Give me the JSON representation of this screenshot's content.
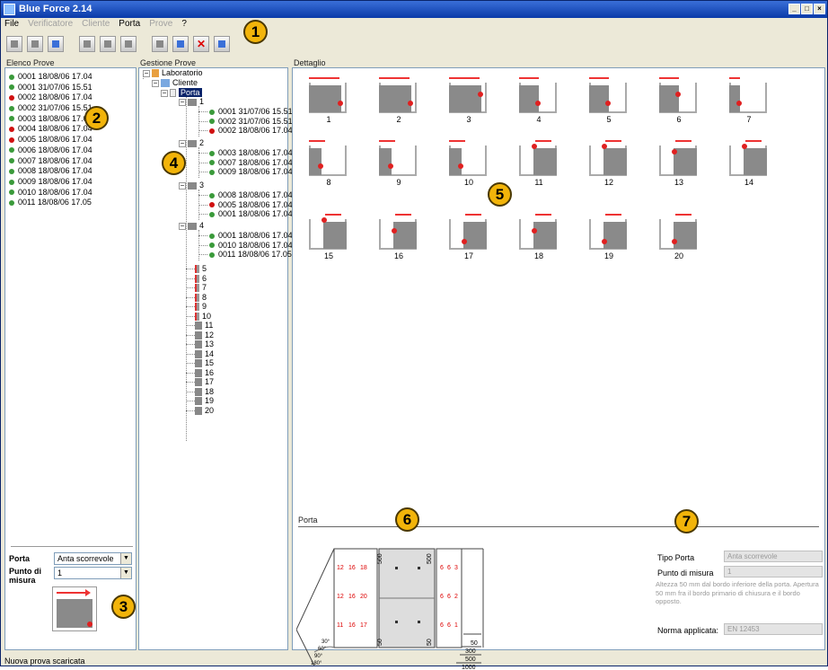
{
  "window": {
    "title": "Blue Force 2.14"
  },
  "menu": [
    {
      "label": "File",
      "enabled": true
    },
    {
      "label": "Verificatore",
      "enabled": false
    },
    {
      "label": "Cliente",
      "enabled": false
    },
    {
      "label": "Porta",
      "enabled": true
    },
    {
      "label": "Prove",
      "enabled": false
    },
    {
      "label": "?",
      "enabled": true
    }
  ],
  "toolbar": {
    "buttons": [
      {
        "icon": "new-doc-icon"
      },
      {
        "icon": "open-doc-icon"
      },
      {
        "icon": "save-icon"
      },
      {
        "icon": "user-icon"
      },
      {
        "icon": "client-icon"
      },
      {
        "icon": "door-icon"
      },
      {
        "icon": "chart-icon"
      },
      {
        "icon": "chart-color-icon"
      },
      {
        "icon": "delete-icon"
      },
      {
        "icon": "print-icon"
      }
    ]
  },
  "left_panel": {
    "title": "Elenco Prove",
    "items": [
      {
        "label": "0001 18/08/06 17.04",
        "status": "green"
      },
      {
        "label": "0001 31/07/06 15.51",
        "status": "green"
      },
      {
        "label": "0002 18/08/06 17.04",
        "status": "red"
      },
      {
        "label": "0002 31/07/06 15.51",
        "status": "green"
      },
      {
        "label": "0003 18/08/06 17.04",
        "status": "green"
      },
      {
        "label": "0004 18/08/06 17.04",
        "status": "red"
      },
      {
        "label": "0005 18/08/06 17.04",
        "status": "red"
      },
      {
        "label": "0006 18/08/06 17.04",
        "status": "green"
      },
      {
        "label": "0007 18/08/06 17.04",
        "status": "green"
      },
      {
        "label": "0008 18/08/06 17.04",
        "status": "green"
      },
      {
        "label": "0009 18/08/06 17.04",
        "status": "green"
      },
      {
        "label": "0010 18/08/06 17.04",
        "status": "green"
      },
      {
        "label": "0011 18/08/06 17.05",
        "status": "green"
      }
    ],
    "porta_label": "Porta",
    "porta_value": "Anta scorrevole",
    "punto_label": "Punto di misura",
    "punto_value": "1"
  },
  "tree_panel": {
    "title": "Gestione Prove",
    "root": "Laboratorio",
    "client": "Cliente",
    "door": "Porta",
    "groups": [
      {
        "num": "1",
        "tests": [
          {
            "label": "0001 31/07/06 15.51",
            "status": "green"
          },
          {
            "label": "0002 31/07/06 15.51",
            "status": "green"
          },
          {
            "label": "0002 18/08/06 17.04",
            "status": "red"
          }
        ]
      },
      {
        "num": "2",
        "tests": [
          {
            "label": "0003 18/08/06 17.04",
            "status": "green"
          },
          {
            "label": "0007 18/08/06 17.04",
            "status": "green"
          },
          {
            "label": "0009 18/08/06 17.04",
            "status": "green"
          }
        ]
      },
      {
        "num": "3",
        "tests": [
          {
            "label": "0008 18/08/06 17.04",
            "status": "green"
          },
          {
            "label": "0005 18/08/06 17.04",
            "status": "red"
          },
          {
            "label": "0001 18/08/06 17.04",
            "status": "green"
          }
        ]
      },
      {
        "num": "4",
        "tests": [
          {
            "label": "0001 18/08/06 17.04",
            "status": "green"
          },
          {
            "label": "0010 18/08/06 17.04",
            "status": "green"
          },
          {
            "label": "0011 18/08/06 17.05",
            "status": "green"
          }
        ]
      }
    ],
    "points": [
      "5",
      "6",
      "7",
      "8",
      "9",
      "10",
      "11",
      "12",
      "13",
      "14",
      "15",
      "16",
      "17",
      "18",
      "19",
      "20"
    ]
  },
  "detail_panel": {
    "title": "Dettaglio",
    "thumbnails": [
      {
        "label": "1",
        "dir": "right"
      },
      {
        "label": "2",
        "dir": "right"
      },
      {
        "label": "3",
        "dir": "right"
      },
      {
        "label": "4",
        "dir": "right"
      },
      {
        "label": "5",
        "dir": "right"
      },
      {
        "label": "6",
        "dir": "right"
      },
      {
        "label": "7",
        "dir": "right"
      },
      {
        "label": "8",
        "dir": "right"
      },
      {
        "label": "9",
        "dir": "right"
      },
      {
        "label": "10",
        "dir": "right"
      },
      {
        "label": "11",
        "dir": "left"
      },
      {
        "label": "12",
        "dir": "left"
      },
      {
        "label": "13",
        "dir": "left"
      },
      {
        "label": "14",
        "dir": "left"
      },
      {
        "label": "15",
        "dir": "left"
      },
      {
        "label": "16",
        "dir": "left"
      },
      {
        "label": "17",
        "dir": "left"
      },
      {
        "label": "18",
        "dir": "left"
      },
      {
        "label": "19",
        "dir": "left"
      },
      {
        "label": "20",
        "dir": "left"
      }
    ]
  },
  "porta_section": {
    "title": "Porta",
    "diagram_left_rows": [
      [
        "12",
        "16",
        "18"
      ],
      [
        "12",
        "16",
        "20"
      ],
      [
        "11",
        "16",
        "17"
      ]
    ],
    "diagram_right_rows": [
      [
        "6",
        "6",
        "3"
      ],
      [
        "6",
        "6",
        "2"
      ],
      [
        "6",
        "6",
        "1"
      ]
    ],
    "dims_vertical": [
      "500",
      "500",
      "50",
      "50"
    ],
    "dims_bottom": [
      "50",
      "300",
      "500",
      "1000"
    ],
    "angles": [
      "30°",
      "60°",
      "90°",
      "180°"
    ],
    "tipo_label": "Tipo Porta",
    "tipo_value": "Anta scorrevole",
    "punto_label": "Punto di misura",
    "punto_value": "1",
    "description": "Altezza 50 mm dal bordo inferiore della porta. Apertura 50 mm fra il bordo primario di chiusura e il bordo opposto.",
    "norma_label": "Norma applicata:",
    "norma_value": "EN 12453"
  },
  "status": "Nuova prova scaricata",
  "callouts": [
    "1",
    "2",
    "3",
    "4",
    "5",
    "6",
    "7"
  ],
  "colors": {
    "accent": "#f2b40a",
    "ok": "#3a9a3a",
    "fail": "#d01010",
    "arrow": "#e33333"
  }
}
